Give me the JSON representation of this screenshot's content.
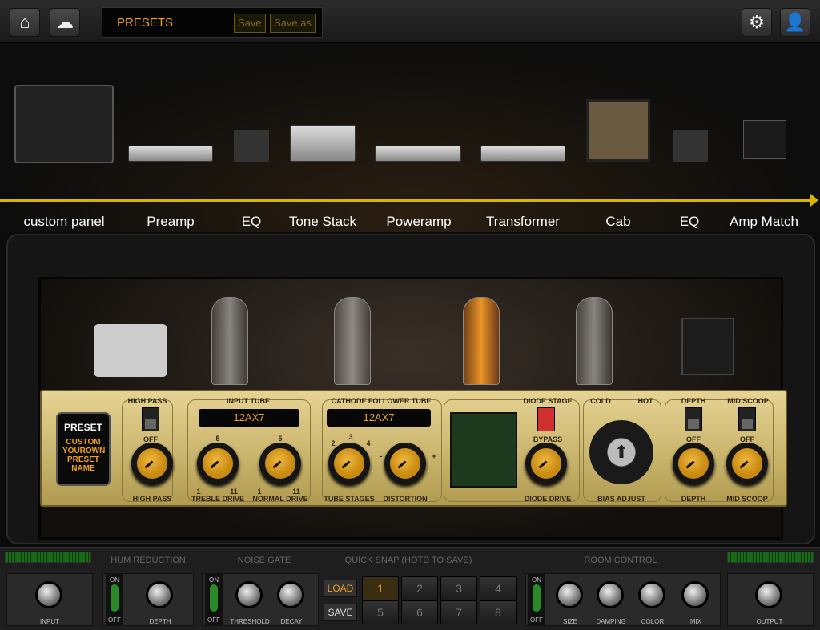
{
  "topbar": {
    "preset_label": "PRESETS",
    "save": "Save",
    "save_as": "Save as",
    "icons": [
      "home-icon",
      "cloud-icon",
      "gear-icon",
      "user-icon"
    ]
  },
  "chain": [
    "custom panel",
    "Preamp",
    "EQ",
    "Tone Stack",
    "Poweramp",
    "Transformer",
    "Cab",
    "EQ",
    "Amp Match"
  ],
  "colors": {
    "accent": "#f0a020",
    "chain_line": "#d8b600",
    "panel_gold": "#d6c27e"
  },
  "panel": {
    "preset_title": "PRESET",
    "preset_name": "CUSTOM YOUROWN PRESET NAME",
    "high_pass": {
      "title": "HIGH PASS",
      "switch": "OFF",
      "knob": "HIGH PASS"
    },
    "input_tube": {
      "title": "INPUT TUBE",
      "tube": "12AX7",
      "scale_top": "5",
      "scale_min": "1",
      "scale_max": "11",
      "knobs": [
        "TREBLE DRIVE",
        "NORMAL DRIVE"
      ]
    },
    "cathode": {
      "title": "CATHODE FOLLOWER TUBE",
      "tube": "12AX7",
      "stages": [
        "2",
        "3",
        "4"
      ],
      "minus": "-",
      "plus": "+",
      "knobs": [
        "TUBE STAGES",
        "DISTORTION"
      ]
    },
    "diode": {
      "title": "DIODE STAGE",
      "switch": "BYPASS",
      "knob": "DIODE DRIVE"
    },
    "bias": {
      "cold": "COLD",
      "hot": "HOT",
      "label": "BIAS ADJUST"
    },
    "eq": {
      "depth_title": "DEPTH",
      "scoop_title": "MID SCOOP",
      "depth_switch": "OFF",
      "scoop_switch": "OFF",
      "knobs": [
        "DEPTH",
        "MID SCOOP"
      ]
    }
  },
  "bottom": {
    "sections": [
      "HUM REDUCTION",
      "NOISE GATE",
      "QUICK SNAP (HOTD TO SAVE)",
      "ROOM CONTROL"
    ],
    "input": "INPUT",
    "output": "OUTPUT",
    "on": "ON",
    "off": "OFF",
    "hum": [
      "DEPTH"
    ],
    "gate": [
      "THRESHOLD",
      "DECAY"
    ],
    "room": [
      "SIZE",
      "DAMPING",
      "COLOR",
      "MIX"
    ],
    "load": "LOAD",
    "save": "SAVE",
    "snaps": [
      "1",
      "2",
      "3",
      "4",
      "5",
      "6",
      "7",
      "8"
    ],
    "active_snap": "1"
  }
}
